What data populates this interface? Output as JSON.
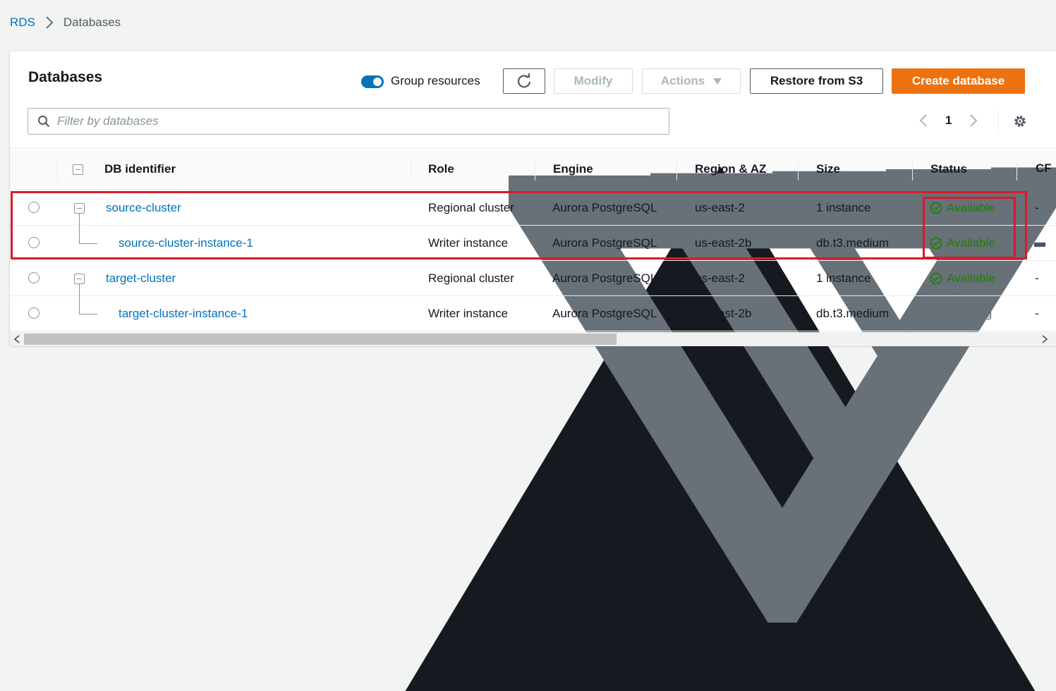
{
  "breadcrumb": {
    "root": "RDS",
    "current": "Databases"
  },
  "panel": {
    "title": "Databases",
    "group_resources_label": "Group resources",
    "group_resources_on": true,
    "buttons": {
      "modify": "Modify",
      "actions": "Actions",
      "restore": "Restore from S3",
      "create": "Create database"
    },
    "filter_placeholder": "Filter by databases",
    "page": "1"
  },
  "table": {
    "headers": {
      "db_identifier": "DB identifier",
      "role": "Role",
      "engine": "Engine",
      "region": "Region & AZ",
      "size": "Size",
      "status": "Status",
      "cut": "CF"
    },
    "rows": [
      {
        "id": "source-cluster",
        "role": "Regional cluster",
        "engine": "Aurora PostgreSQL",
        "region": "us-east-2",
        "size": "1 instance",
        "status": "Available",
        "extra": "-"
      },
      {
        "id": "source-cluster-instance-1",
        "role": "Writer instance",
        "engine": "Aurora PostgreSQL",
        "region": "us-east-2b",
        "size": "db.t3.medium",
        "status": "Available",
        "extra": ""
      },
      {
        "id": "target-cluster",
        "role": "Regional cluster",
        "engine": "Aurora PostgreSQL",
        "region": "us-east-2",
        "size": "1 instance",
        "status": "Available",
        "extra": "-"
      },
      {
        "id": "target-cluster-instance-1",
        "role": "Writer instance",
        "engine": "Aurora PostgreSQL",
        "region": "us-east-2b",
        "size": "db.t3.medium",
        "status": "Creating",
        "extra": "-"
      }
    ]
  },
  "colors": {
    "accent": "#0073bb",
    "primary": "#ec7211",
    "success": "#1d8102",
    "highlight": "#d91a2a"
  }
}
